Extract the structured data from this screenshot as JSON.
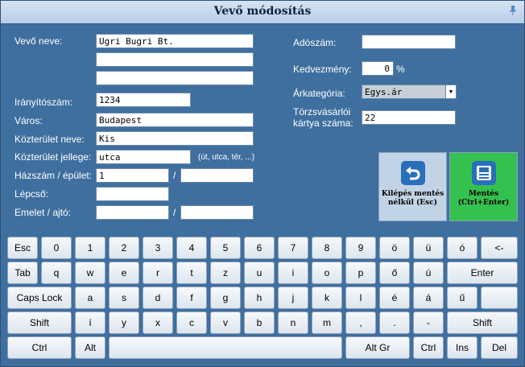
{
  "window": {
    "title": "Vevő módosítás"
  },
  "form": {
    "labels": {
      "name": "Vevő neve:",
      "zip": "Irányítószám:",
      "city": "Város:",
      "street_name": "Közterület neve:",
      "street_type": "Közterület jellege:",
      "house_number": "Házszám / épület:",
      "stairs": "Lépcső:",
      "floor_door": "Emelet / ajtó:",
      "tax_number": "Adószám:",
      "discount": "Kedvezmény:",
      "price_category": "Árkategória:",
      "loyalty_card_line1": "Törzsvásárlói",
      "loyalty_card_line2": "kártya száma:"
    },
    "values": {
      "name1": "Ugri Bugri Bt.",
      "name2": "",
      "name3": "",
      "zip": "1234",
      "city": "Budapest",
      "street_name": "Kis",
      "street_type": "utca",
      "house_number": "1",
      "building": "",
      "stairs": "",
      "floor": "",
      "door": "",
      "tax_number": "",
      "discount": "0",
      "price_category": "Egys.ár",
      "loyalty_card": "22"
    },
    "street_type_hint": "(út, utca, tér, ...)",
    "slash": "/",
    "percent": "%"
  },
  "buttons": {
    "exit_line1": "Kilépés mentés",
    "exit_line2": "nélkül (Esc)",
    "save_line1": "Mentés",
    "save_line2": "(Ctrl+Enter)"
  },
  "keyboard": {
    "row1": [
      "Esc",
      "0",
      "1",
      "2",
      "3",
      "4",
      "5",
      "6",
      "7",
      "8",
      "9",
      "ö",
      "ü",
      "ó",
      "<-"
    ],
    "row2": [
      "Tab",
      "q",
      "w",
      "e",
      "r",
      "t",
      "z",
      "u",
      "i",
      "o",
      "p",
      "ő",
      "ú",
      "Enter"
    ],
    "row3": [
      "Caps Lock",
      "a",
      "s",
      "d",
      "f",
      "g",
      "h",
      "j",
      "k",
      "l",
      "é",
      "á",
      "ű",
      ""
    ],
    "row4": [
      "Shift",
      "í",
      "y",
      "x",
      "c",
      "v",
      "b",
      "n",
      "m",
      ",",
      ".",
      "-",
      "Shift"
    ],
    "row5": [
      "Ctrl",
      "Alt",
      "",
      "Alt Gr",
      "Ctrl",
      "Ins",
      "Del"
    ]
  },
  "colors": {
    "background": "#3f6f9f",
    "save_button": "#35c150",
    "exit_button": "#c3d3e6",
    "icon_blue": "#2a6fb8"
  }
}
